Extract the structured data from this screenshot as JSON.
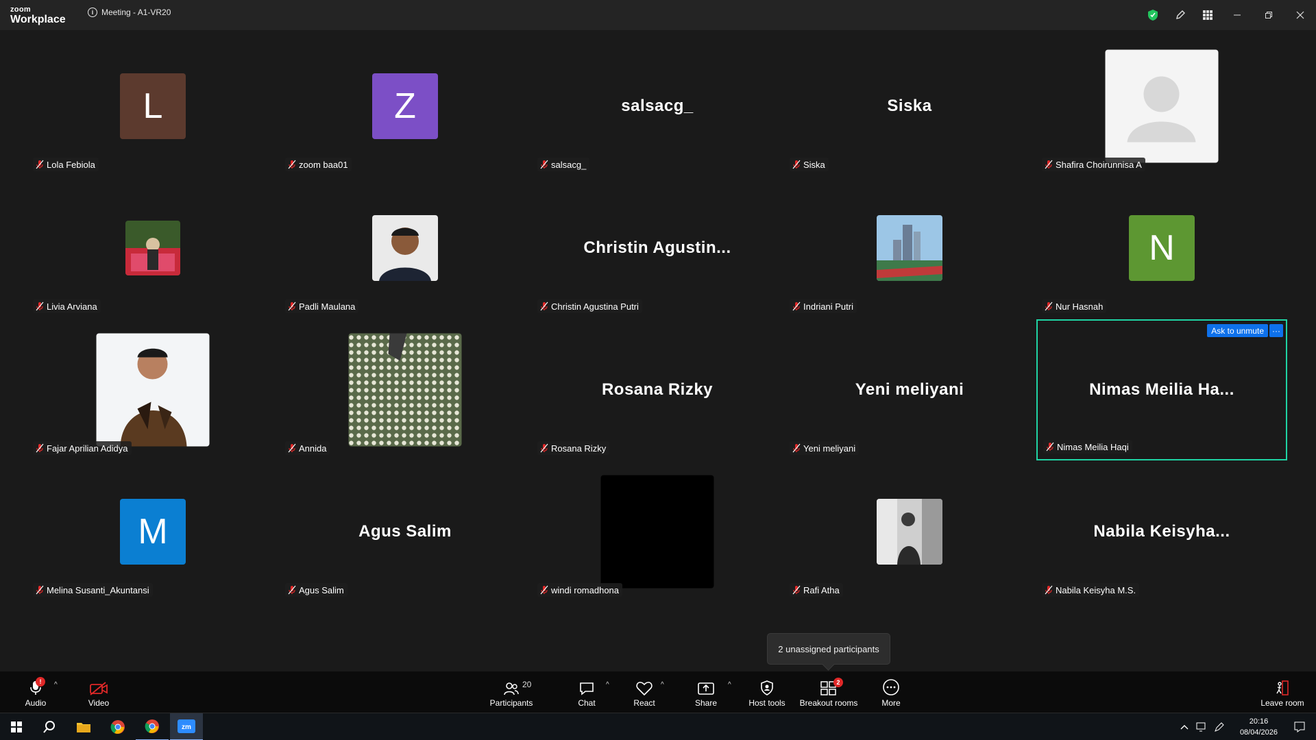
{
  "titlebar": {
    "brand_top": "zoom",
    "brand_bottom": "Workplace",
    "meeting_title": "Meeting - A1-VR20",
    "info_icon": "i"
  },
  "participants": [
    {
      "name": "Lola Febiola",
      "display": "letter",
      "letter": "L",
      "color": "#5c3a2e"
    },
    {
      "name": "zoom baa01",
      "display": "letter",
      "letter": "Z",
      "color": "#7c4fc6"
    },
    {
      "name": "salsacg_",
      "display": "text",
      "big": "salsacg_"
    },
    {
      "name": "Siska",
      "display": "text",
      "big": "Siska"
    },
    {
      "name": "Shafira Choirunnisa A",
      "display": "placeholder"
    },
    {
      "name": "Livia Arviana",
      "display": "photo-small"
    },
    {
      "name": "Padli Maulana",
      "display": "photo"
    },
    {
      "name": "Christin Agustina Putri",
      "display": "text",
      "big": "Christin  Agustin..."
    },
    {
      "name": "Indriani Putri",
      "display": "photo"
    },
    {
      "name": "Nur Hasnah",
      "display": "letter",
      "letter": "N",
      "color": "#5d9732"
    },
    {
      "name": "Fajar Aprilian Adidya",
      "display": "photo-lg"
    },
    {
      "name": "Annida",
      "display": "photo-lg"
    },
    {
      "name": "Rosana Rizky",
      "display": "text",
      "big": "Rosana Rizky"
    },
    {
      "name": "Yeni meliyani",
      "display": "text",
      "big": "Yeni meliyani"
    },
    {
      "name": "Nimas Meilia Haqi",
      "display": "text",
      "big": "Nimas Meilia Ha...",
      "active": true
    },
    {
      "name": "Melina Susanti_Akuntansi",
      "display": "letter",
      "letter": "M",
      "color": "#0b7fd2"
    },
    {
      "name": "Agus Salim",
      "display": "text",
      "big": "Agus Salim"
    },
    {
      "name": "windi romadhona",
      "display": "black"
    },
    {
      "name": "Rafi Atha",
      "display": "photo"
    },
    {
      "name": "Nabila Keisyha M.S.",
      "display": "text",
      "big": "Nabila  Keisyha..."
    }
  ],
  "active_tile": {
    "ask_unmute": "Ask to unmute",
    "more": "···"
  },
  "tooltip": "2 unassigned participants",
  "toolbar": {
    "audio": "Audio",
    "video": "Video",
    "participants": "Participants",
    "participants_count": "20",
    "chat": "Chat",
    "react": "React",
    "share": "Share",
    "host_tools": "Host tools",
    "breakout": "Breakout rooms",
    "breakout_badge": "2",
    "more": "More",
    "leave": "Leave room",
    "caret": "^"
  },
  "taskbar": {
    "time": "20:16",
    "date": "08/04/2026"
  },
  "colors": {
    "accent": "#0e71eb",
    "active_speaker": "#1fd4a4",
    "muted": "#e02828",
    "security": "#23c55e"
  }
}
